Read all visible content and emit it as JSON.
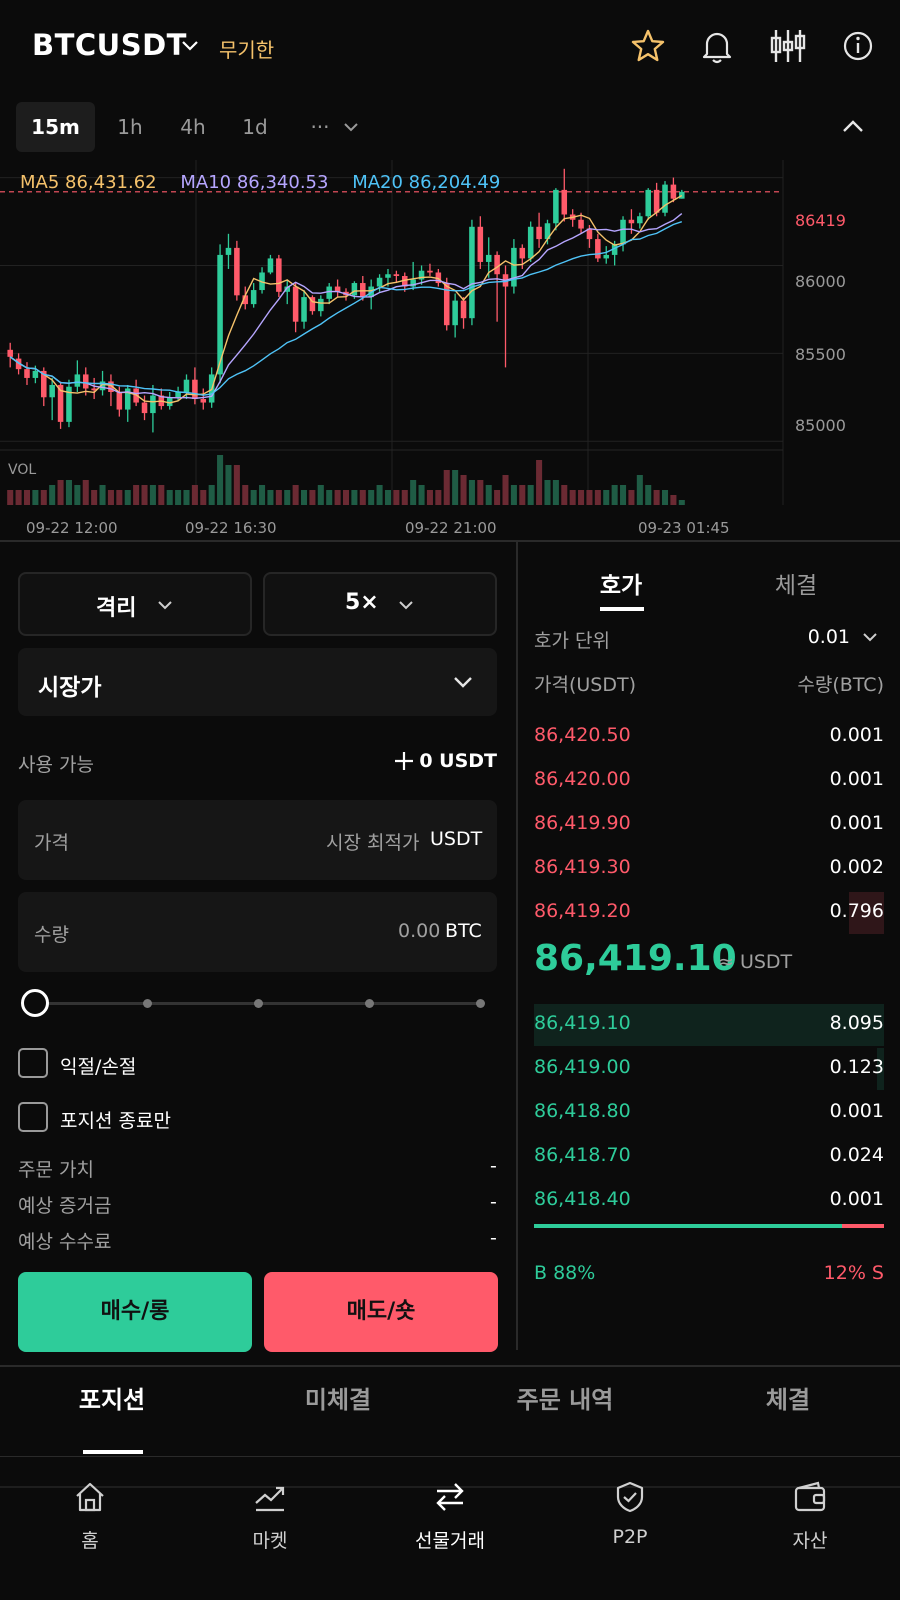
{
  "header": {
    "symbol": "BTCUSDT",
    "contract_type": "무기한",
    "icons": [
      "star-icon",
      "bell-icon",
      "candlestick-settings-icon",
      "info-icon"
    ],
    "colors": {
      "accent": "#f5c26b"
    }
  },
  "timeframes": {
    "items": [
      "15m",
      "1h",
      "4h",
      "1d",
      "···"
    ],
    "selected": "15m"
  },
  "chart": {
    "ma5": "MA5 86,431.62",
    "ma10": "MA10 86,340.53",
    "ma20": "MA20 86,204.49",
    "last_price": "86419",
    "vol_label": "VOL",
    "colors": {
      "up": "#2ecc9a",
      "down": "#ff5a6a",
      "ma5": "#f5c26b",
      "ma10": "#b6a6ff",
      "ma20": "#4fc3f7"
    }
  },
  "chart_data": {
    "type": "candlestick",
    "y_ticks": [
      "86000",
      "85500",
      "85000"
    ],
    "x_ticks": [
      "09-22 12:00",
      "09-22 16:30",
      "09-22 21:00",
      "09-23 01:45"
    ],
    "ylim": [
      84950,
      86600
    ],
    "last_price": 86419,
    "candles": [
      {
        "o": 85520,
        "h": 85560,
        "l": 85420,
        "c": 85480
      },
      {
        "o": 85470,
        "h": 85500,
        "l": 85380,
        "c": 85410
      },
      {
        "o": 85410,
        "h": 85450,
        "l": 85320,
        "c": 85360
      },
      {
        "o": 85360,
        "h": 85430,
        "l": 85330,
        "c": 85400
      },
      {
        "o": 85400,
        "h": 85420,
        "l": 85200,
        "c": 85250
      },
      {
        "o": 85250,
        "h": 85360,
        "l": 85120,
        "c": 85320
      },
      {
        "o": 85320,
        "h": 85340,
        "l": 85070,
        "c": 85110
      },
      {
        "o": 85110,
        "h": 85350,
        "l": 85080,
        "c": 85310
      },
      {
        "o": 85310,
        "h": 85460,
        "l": 85280,
        "c": 85380
      },
      {
        "o": 85380,
        "h": 85420,
        "l": 85260,
        "c": 85300
      },
      {
        "o": 85300,
        "h": 85360,
        "l": 85240,
        "c": 85290
      },
      {
        "o": 85290,
        "h": 85400,
        "l": 85260,
        "c": 85340
      },
      {
        "o": 85340,
        "h": 85380,
        "l": 85200,
        "c": 85280
      },
      {
        "o": 85280,
        "h": 85310,
        "l": 85140,
        "c": 85180
      },
      {
        "o": 85180,
        "h": 85320,
        "l": 85110,
        "c": 85300
      },
      {
        "o": 85300,
        "h": 85350,
        "l": 85200,
        "c": 85220
      },
      {
        "o": 85220,
        "h": 85260,
        "l": 85120,
        "c": 85160
      },
      {
        "o": 85160,
        "h": 85320,
        "l": 85050,
        "c": 85260
      },
      {
        "o": 85260,
        "h": 85300,
        "l": 85180,
        "c": 85200
      },
      {
        "o": 85200,
        "h": 85280,
        "l": 85180,
        "c": 85250
      },
      {
        "o": 85250,
        "h": 85310,
        "l": 85230,
        "c": 85280
      },
      {
        "o": 85280,
        "h": 85380,
        "l": 85240,
        "c": 85350
      },
      {
        "o": 85350,
        "h": 85420,
        "l": 85210,
        "c": 85240
      },
      {
        "o": 85240,
        "h": 85300,
        "l": 85180,
        "c": 85220
      },
      {
        "o": 85220,
        "h": 85420,
        "l": 85190,
        "c": 85380
      },
      {
        "o": 85380,
        "h": 86120,
        "l": 85330,
        "c": 86060
      },
      {
        "o": 86060,
        "h": 86180,
        "l": 85980,
        "c": 86100
      },
      {
        "o": 86100,
        "h": 86140,
        "l": 85800,
        "c": 85830
      },
      {
        "o": 85830,
        "h": 85880,
        "l": 85750,
        "c": 85780
      },
      {
        "o": 85780,
        "h": 85900,
        "l": 85760,
        "c": 85860
      },
      {
        "o": 85860,
        "h": 85990,
        "l": 85840,
        "c": 85960
      },
      {
        "o": 85960,
        "h": 86060,
        "l": 85950,
        "c": 86040
      },
      {
        "o": 86040,
        "h": 86060,
        "l": 85820,
        "c": 85850
      },
      {
        "o": 85850,
        "h": 85920,
        "l": 85780,
        "c": 85880
      },
      {
        "o": 85880,
        "h": 85900,
        "l": 85620,
        "c": 85680
      },
      {
        "o": 85680,
        "h": 85860,
        "l": 85640,
        "c": 85820
      },
      {
        "o": 85820,
        "h": 85830,
        "l": 85720,
        "c": 85740
      },
      {
        "o": 85740,
        "h": 85830,
        "l": 85710,
        "c": 85810
      },
      {
        "o": 85810,
        "h": 85900,
        "l": 85780,
        "c": 85880
      },
      {
        "o": 85880,
        "h": 85920,
        "l": 85820,
        "c": 85850
      },
      {
        "o": 85850,
        "h": 85870,
        "l": 85800,
        "c": 85830
      },
      {
        "o": 85830,
        "h": 85910,
        "l": 85810,
        "c": 85900
      },
      {
        "o": 85900,
        "h": 85940,
        "l": 85800,
        "c": 85820
      },
      {
        "o": 85820,
        "h": 85920,
        "l": 85750,
        "c": 85880
      },
      {
        "o": 85880,
        "h": 85950,
        "l": 85850,
        "c": 85930
      },
      {
        "o": 85930,
        "h": 85980,
        "l": 85880,
        "c": 85950
      },
      {
        "o": 85950,
        "h": 85970,
        "l": 85900,
        "c": 85940
      },
      {
        "o": 85940,
        "h": 85960,
        "l": 85850,
        "c": 85880
      },
      {
        "o": 85880,
        "h": 86020,
        "l": 85860,
        "c": 85920
      },
      {
        "o": 85920,
        "h": 86000,
        "l": 85890,
        "c": 85970
      },
      {
        "o": 85970,
        "h": 86010,
        "l": 85940,
        "c": 85960
      },
      {
        "o": 85960,
        "h": 85980,
        "l": 85880,
        "c": 85900
      },
      {
        "o": 85900,
        "h": 85930,
        "l": 85630,
        "c": 85660
      },
      {
        "o": 85660,
        "h": 85840,
        "l": 85590,
        "c": 85800
      },
      {
        "o": 85800,
        "h": 85820,
        "l": 85640,
        "c": 85700
      },
      {
        "o": 85700,
        "h": 86260,
        "l": 85660,
        "c": 86220
      },
      {
        "o": 86220,
        "h": 86280,
        "l": 85980,
        "c": 86020
      },
      {
        "o": 86020,
        "h": 86160,
        "l": 85930,
        "c": 86060
      },
      {
        "o": 86060,
        "h": 86080,
        "l": 85680,
        "c": 85950
      },
      {
        "o": 85950,
        "h": 86000,
        "l": 85420,
        "c": 85880
      },
      {
        "o": 85880,
        "h": 86150,
        "l": 85840,
        "c": 86100
      },
      {
        "o": 86100,
        "h": 86120,
        "l": 85980,
        "c": 86040
      },
      {
        "o": 86040,
        "h": 86250,
        "l": 86020,
        "c": 86220
      },
      {
        "o": 86220,
        "h": 86300,
        "l": 86100,
        "c": 86150
      },
      {
        "o": 86150,
        "h": 86260,
        "l": 86120,
        "c": 86240
      },
      {
        "o": 86240,
        "h": 86440,
        "l": 86200,
        "c": 86430
      },
      {
        "o": 86430,
        "h": 86550,
        "l": 86250,
        "c": 86290
      },
      {
        "o": 86290,
        "h": 86320,
        "l": 86220,
        "c": 86260
      },
      {
        "o": 86260,
        "h": 86300,
        "l": 86180,
        "c": 86210
      },
      {
        "o": 86210,
        "h": 86230,
        "l": 86100,
        "c": 86150
      },
      {
        "o": 86150,
        "h": 86180,
        "l": 86020,
        "c": 86040
      },
      {
        "o": 86040,
        "h": 86110,
        "l": 86010,
        "c": 86060
      },
      {
        "o": 86060,
        "h": 86140,
        "l": 86000,
        "c": 86120
      },
      {
        "o": 86120,
        "h": 86280,
        "l": 86080,
        "c": 86260
      },
      {
        "o": 86260,
        "h": 86320,
        "l": 86180,
        "c": 86240
      },
      {
        "o": 86240,
        "h": 86300,
        "l": 86210,
        "c": 86280
      },
      {
        "o": 86280,
        "h": 86440,
        "l": 86260,
        "c": 86430
      },
      {
        "o": 86430,
        "h": 86470,
        "l": 86280,
        "c": 86300
      },
      {
        "o": 86300,
        "h": 86480,
        "l": 86280,
        "c": 86460
      },
      {
        "o": 86460,
        "h": 86500,
        "l": 86360,
        "c": 86380
      },
      {
        "o": 86380,
        "h": 86430,
        "l": 86380,
        "c": 86419
      }
    ],
    "volume": [
      3,
      3,
      3,
      3,
      3,
      4,
      5,
      5,
      4,
      5,
      3,
      4,
      3,
      3,
      3,
      4,
      4,
      4,
      4,
      3,
      3,
      3,
      4,
      3,
      4,
      10,
      8,
      8,
      4,
      3,
      4,
      3,
      3,
      3,
      4,
      3,
      3,
      4,
      3,
      3,
      3,
      3,
      3,
      3,
      4,
      3,
      3,
      3,
      5,
      4,
      3,
      3,
      7,
      7,
      6,
      5,
      5,
      4,
      3,
      6,
      4,
      4,
      4,
      9,
      5,
      5,
      4,
      3,
      3,
      3,
      3,
      3,
      4,
      4,
      3,
      6,
      4,
      3,
      3,
      2,
      1
    ]
  },
  "order_form": {
    "margin_mode": "격리",
    "leverage": "5×",
    "order_type": "시장가",
    "available_label": "사용 가능",
    "available_value": "0 USDT",
    "price_label": "가격",
    "price_placeholder": "시장 최적가",
    "price_unit": "USDT",
    "qty_label": "수량",
    "qty_placeholder": "0.00",
    "qty_unit": "BTC",
    "slider_percent": 0,
    "tp_sl_label": "익절/손절",
    "reduce_only_label": "포지션 종료만",
    "order_value_label": "주문 가치",
    "order_value": "-",
    "est_margin_label": "예상 증거금",
    "est_margin": "-",
    "est_fee_label": "예상 수수료",
    "est_fee": "-",
    "buy_label": "매수/롱",
    "sell_label": "매도/숏",
    "colors": {
      "buy": "#2ecc9a",
      "sell": "#ff5a6a"
    }
  },
  "order_book": {
    "tab_book": "호가",
    "tab_trades": "체결",
    "tick_label": "호가 단위",
    "tick_value": "0.01",
    "col_price": "가격(USDT)",
    "col_qty": "수량(BTC)",
    "asks": [
      {
        "price": "86,420.50",
        "qty": "0.001",
        "depth": 0
      },
      {
        "price": "86,420.00",
        "qty": "0.001",
        "depth": 0
      },
      {
        "price": "86,419.90",
        "qty": "0.001",
        "depth": 0
      },
      {
        "price": "86,419.30",
        "qty": "0.002",
        "depth": 0
      },
      {
        "price": "86,419.20",
        "qty": "0.796",
        "depth": 0.1
      }
    ],
    "mid_price": "86,419.10",
    "mid_unit": "≈ USDT",
    "bids": [
      {
        "price": "86,419.10",
        "qty": "8.095",
        "depth": 1.0
      },
      {
        "price": "86,419.00",
        "qty": "0.123",
        "depth": 0.02
      },
      {
        "price": "86,418.80",
        "qty": "0.001",
        "depth": 0
      },
      {
        "price": "86,418.70",
        "qty": "0.024",
        "depth": 0
      },
      {
        "price": "86,418.40",
        "qty": "0.001",
        "depth": 0
      }
    ],
    "buy_ratio": 88,
    "buy_ratio_label": "B 88%",
    "sell_ratio_label": "12% S"
  },
  "bottom_tabs": {
    "items": [
      "포지션",
      "미체결",
      "주문 내역",
      "체결"
    ],
    "selected": "포지션"
  },
  "nav": {
    "items": [
      {
        "label": "홈",
        "icon": "home-icon"
      },
      {
        "label": "마켓",
        "icon": "market-chart-icon"
      },
      {
        "label": "선물거래",
        "icon": "swap-arrows-icon"
      },
      {
        "label": "P2P",
        "icon": "shield-check-icon"
      },
      {
        "label": "자산",
        "icon": "wallet-icon"
      }
    ],
    "selected": "선물거래"
  }
}
